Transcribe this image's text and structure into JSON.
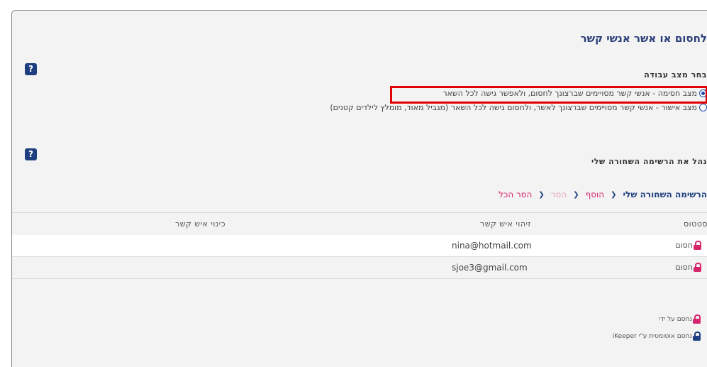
{
  "page": {
    "title": "לחסום או אשר אנשי קשר"
  },
  "work_mode": {
    "label": "בחר מצב עבודה",
    "options": [
      {
        "label": "מצב חסימה - אנשי קשר מסויימים שברצונך לחסום, ולאפשר גישה לכל השאר",
        "selected": true
      },
      {
        "label": "מצב אישור - אנשי קשר מסויימים שברצונך לאשר, ולחסום גישה לכל השאר (מגביל מאוד, מומלץ לילדים קטנים)",
        "selected": false
      }
    ]
  },
  "blacklist": {
    "label": "נהל את הרשימה השחורה שלי",
    "tabs": {
      "main": "הרשימה השחורה שלי",
      "add": "הוסף",
      "remove": "הסר",
      "remove_all": "הסר הכל"
    },
    "columns": {
      "status": "סטטוס",
      "contact_id": "זיהוי איש קשר",
      "contact_nick": "כינוי איש קשר"
    },
    "rows": [
      {
        "status": "חסום",
        "contact_id": "nina@hotmail.com",
        "contact_nick": ""
      },
      {
        "status": "חסום",
        "contact_id": "sjoe3@gmail.com",
        "contact_nick": ""
      }
    ]
  },
  "legend": {
    "blocked_by_me": "נחסם על ידי",
    "blocked_auto": "נחסם אוטומטית ע\"י iKeeper"
  },
  "help": {
    "icon_label": "?"
  },
  "colors": {
    "accent_blue": "#1d3f80",
    "link_pink": "#d6266b",
    "highlight_red": "#e30000"
  }
}
